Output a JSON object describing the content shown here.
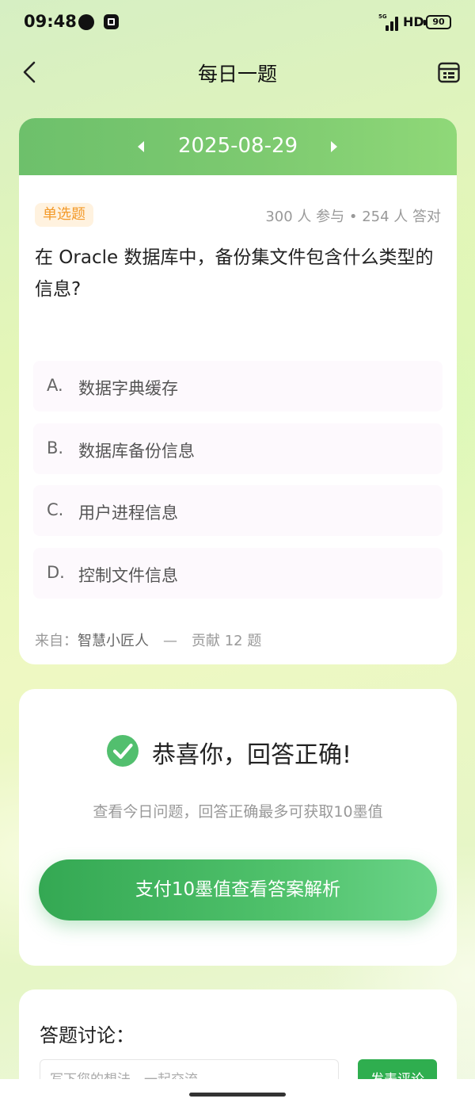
{
  "status_bar": {
    "time": "09:48",
    "network": "5G",
    "hd": "HD",
    "battery": "90"
  },
  "nav": {
    "title": "每日一题",
    "back_icon": "chevron-left-icon",
    "right_icon": "calendar-icon"
  },
  "question": {
    "date": "2025-08-29",
    "type": "单选题",
    "stats": "300 人 参与 • 254 人 答对",
    "text": "在 Oracle 数据库中，备份集文件包含什么类型的信息?",
    "options": [
      {
        "letter": "A.",
        "text": "数据字典缓存"
      },
      {
        "letter": "B.",
        "text": "数据库备份信息"
      },
      {
        "letter": "C.",
        "text": "用户进程信息"
      },
      {
        "letter": "D.",
        "text": "控制文件信息"
      }
    ],
    "source_prefix": "来自：",
    "source_author": "智慧小匠人",
    "source_suffix": "—　贡献 12 题"
  },
  "result": {
    "icon": "check-circle-icon",
    "title": "恭喜你，回答正确!",
    "desc": "查看今日问题，回答正确最多可获取10墨值",
    "pay_button": "支付10墨值查看答案解析"
  },
  "discussion": {
    "title": "答题讨论：",
    "input_placeholder": "写下您的想法，一起交流",
    "submit_button": "发表评论"
  },
  "colors": {
    "accent": "#4fc16b",
    "badge_text": "#f39a2a",
    "badge_bg": "#fff2df"
  }
}
